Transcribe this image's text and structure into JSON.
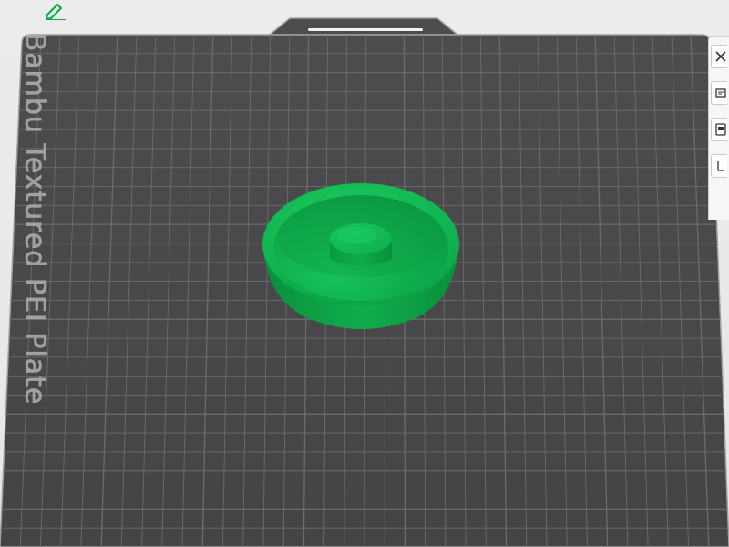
{
  "plate": {
    "label": "Bambu Textured PEI Plate"
  },
  "colors": {
    "plate_surface": "#4a4a4c",
    "grid_line": "#6c6c6e",
    "plate_border": "#9a9a9c",
    "model_green": "#0cb04c",
    "model_green_dark": "#078836",
    "accent_green": "#00ae42"
  },
  "icons": {
    "edit": "pencil-icon",
    "toolbar": [
      "close-icon",
      "auto-orient-icon",
      "arrange-icon",
      "layer-icon"
    ]
  }
}
